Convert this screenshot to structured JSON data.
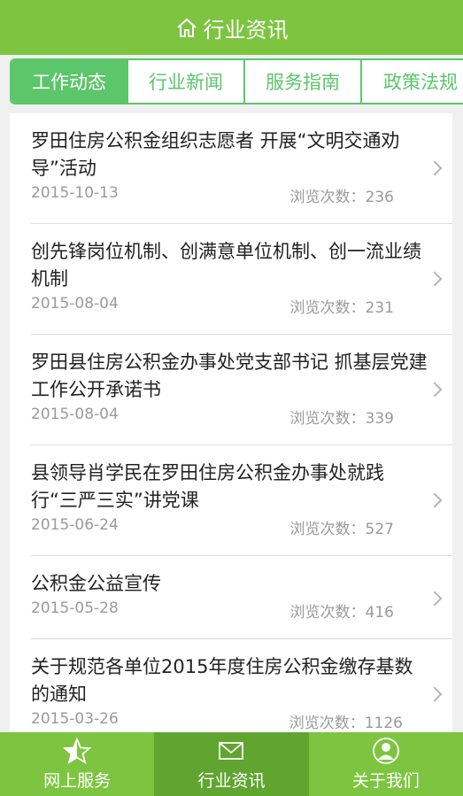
{
  "header": {
    "title": "行业资讯",
    "icon": "home-icon"
  },
  "tabs": [
    {
      "label": "工作动态",
      "active": true
    },
    {
      "label": "行业新闻",
      "active": false
    },
    {
      "label": "服务指南",
      "active": false
    },
    {
      "label": "政策法规",
      "active": false
    }
  ],
  "articles": [
    {
      "title": "罗田住房公积金组织志愿者 开展“文明交通劝导”活动",
      "date": "2015-10-13",
      "views": "浏览次数：236"
    },
    {
      "title": "创先锋岗位机制、创满意单位机制、创一流业绩机制",
      "date": "2015-08-04",
      "views": "浏览次数：231"
    },
    {
      "title": "罗田县住房公积金办事处党支部书记 抓基层党建工作公开承诺书",
      "date": "2015-08-04",
      "views": "浏览次数：339"
    },
    {
      "title": "县领导肖学民在罗田住房公积金办事处就践行“三严三实”讲党课",
      "date": "2015-06-24",
      "views": "浏览次数：527"
    },
    {
      "title": "公积金公益宣传",
      "date": "2015-05-28",
      "views": "浏览次数：416"
    },
    {
      "title": "关于规范各单位2015年度住房公积金缴存基数的通知",
      "date": "2015-03-26",
      "views": "浏览次数：1126"
    }
  ],
  "bottom_nav": [
    {
      "label": "网上服务",
      "icon": "star-icon",
      "active": false
    },
    {
      "label": "行业资讯",
      "icon": "mail-icon",
      "active": true
    },
    {
      "label": "关于我们",
      "icon": "person-icon",
      "active": false
    }
  ],
  "colors": {
    "header_green": "#7dc540",
    "tab_green": "#5cc66a",
    "nav_active": "#5fa52f"
  }
}
